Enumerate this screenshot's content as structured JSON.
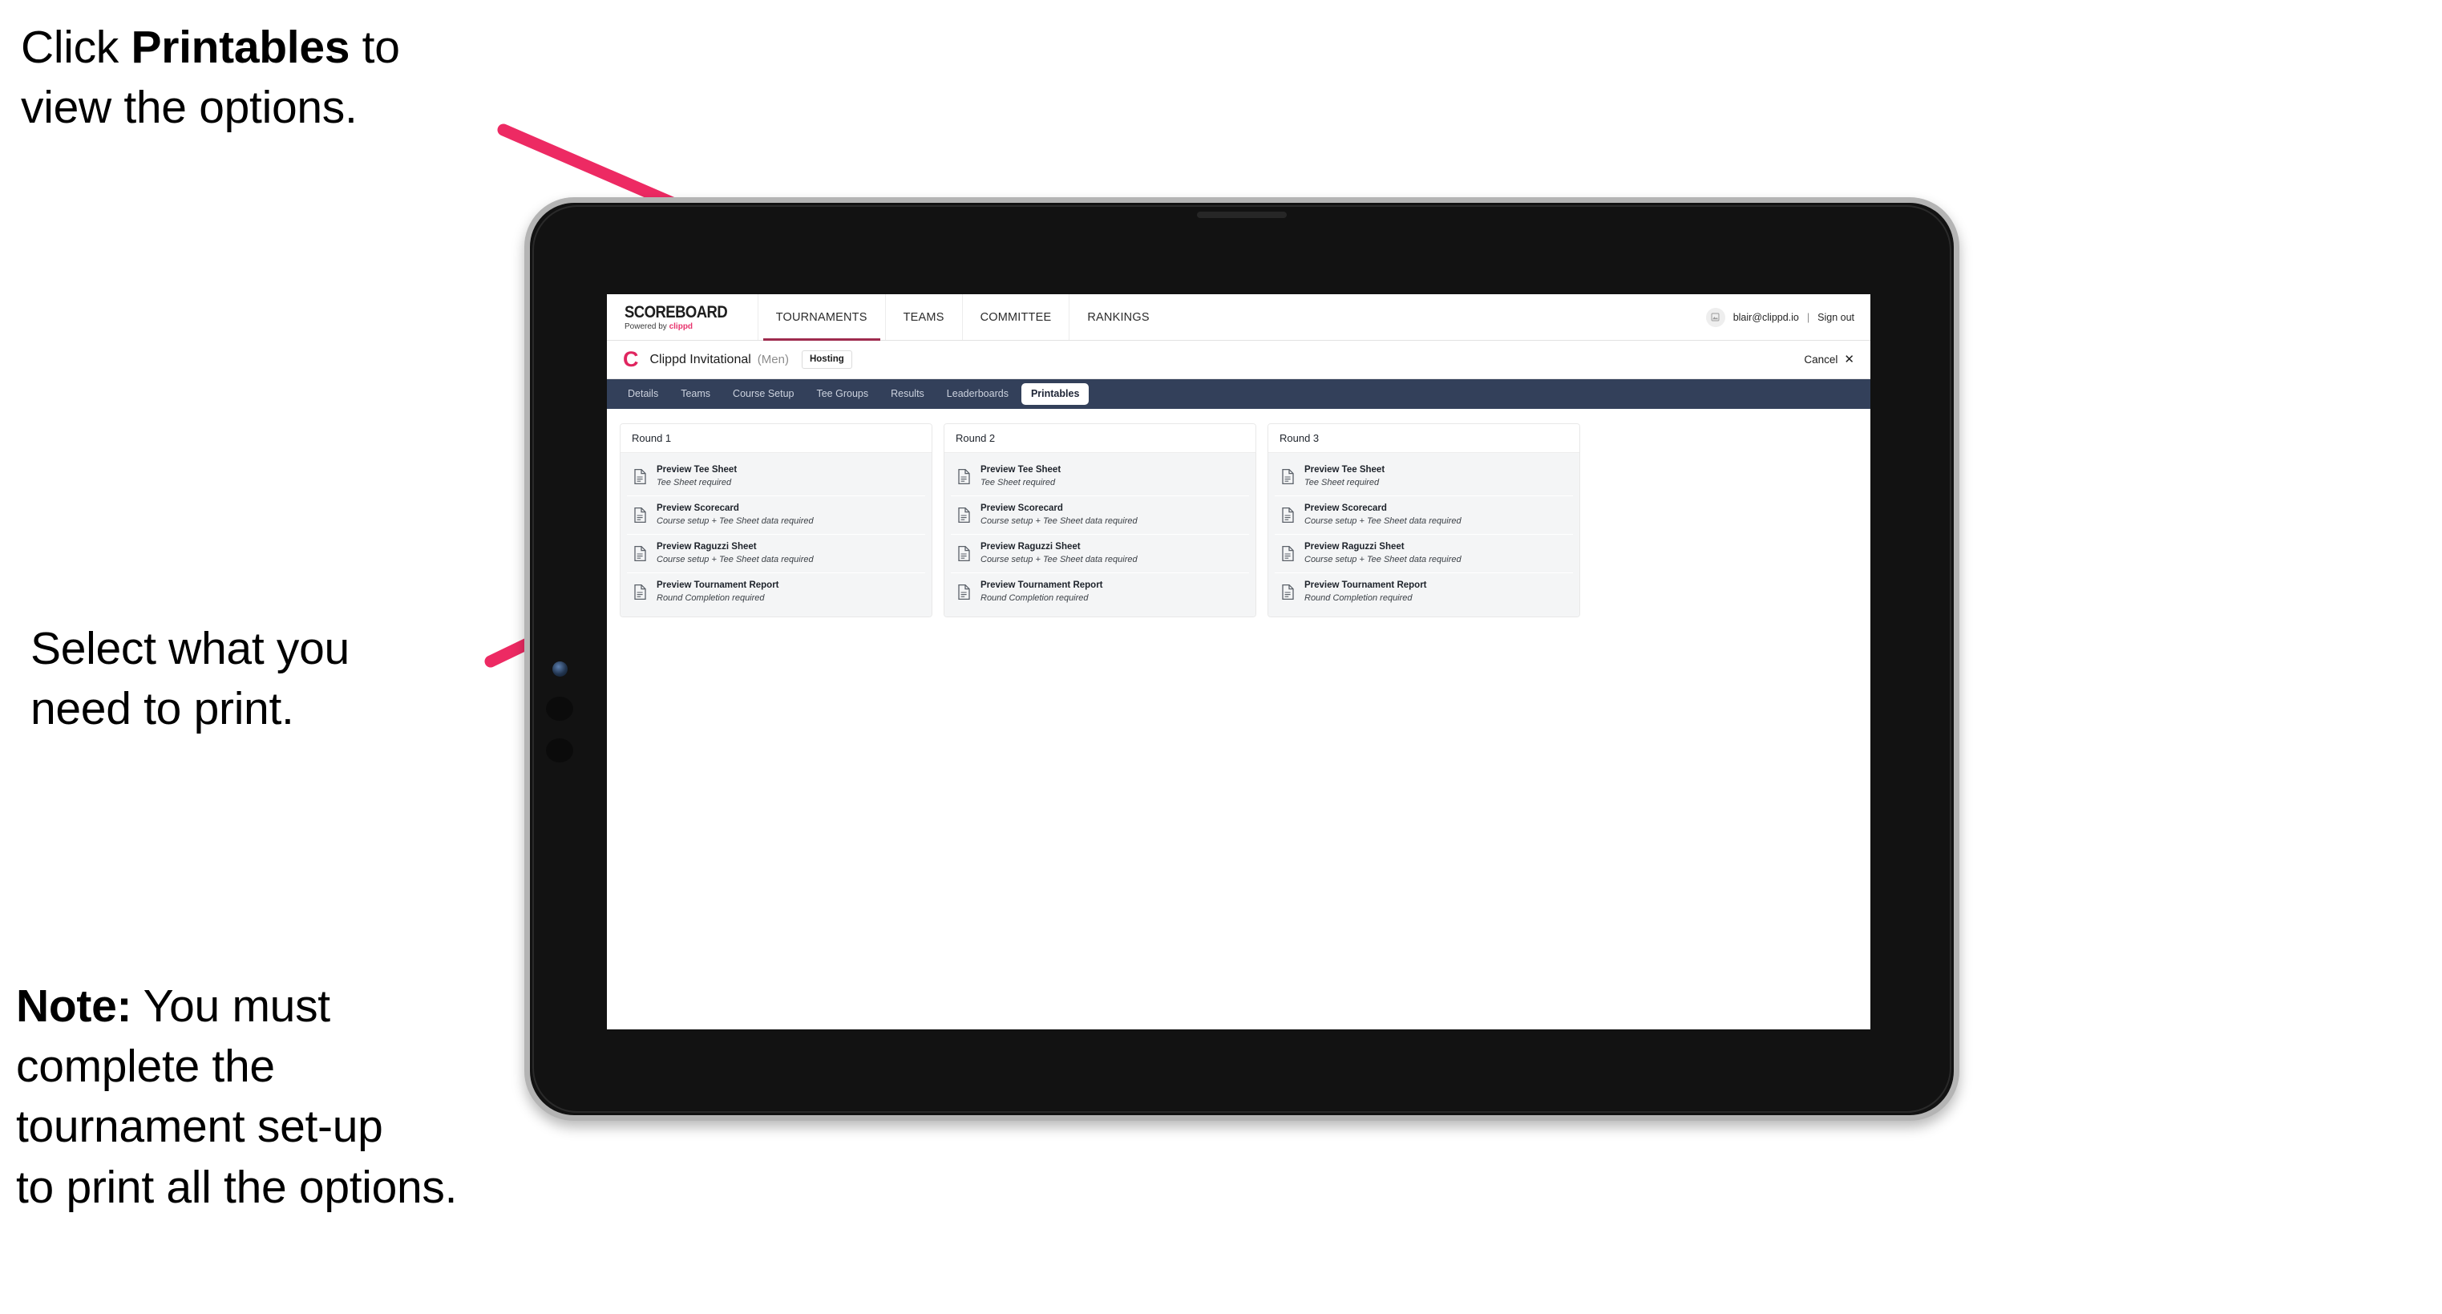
{
  "annotations": {
    "click_printables": "Click ",
    "click_printables_bold": "Printables",
    "click_printables_tail": " to\nview the options.",
    "select_print": "Select what you\n need to print.",
    "note_label": "Note:",
    "note_body": " You must\ncomplete the\ntournament set-up\nto print all the options."
  },
  "colors": {
    "arrow_pink": "#ED2A63",
    "tabstrip_navy": "#33405A",
    "clippd_pink": "#E0255F",
    "nav_active_underline": "#9E2B4E"
  },
  "screen": {
    "topbar": {
      "brand_title": "SCOREBOARD",
      "brand_sub_prefix": "Powered by ",
      "brand_sub_word": "clippd",
      "nav_items": [
        {
          "label": "TOURNAMENTS",
          "active": true
        },
        {
          "label": "TEAMS",
          "active": false
        },
        {
          "label": "COMMITTEE",
          "active": false
        },
        {
          "label": "RANKINGS",
          "active": false
        }
      ],
      "avatar_icon": "user-avatar-icon",
      "user_email": "blair@clippd.io",
      "separator": "|",
      "sign_out": "Sign out"
    },
    "subheader": {
      "logo_letter": "C",
      "tournament_name": "Clippd Invitational",
      "gender": "(Men)",
      "hosting_badge": "Hosting",
      "cancel_label": "Cancel",
      "cancel_icon": "close-icon"
    },
    "tabs": [
      {
        "label": "Details",
        "active": false
      },
      {
        "label": "Teams",
        "active": false
      },
      {
        "label": "Course Setup",
        "active": false
      },
      {
        "label": "Tee Groups",
        "active": false
      },
      {
        "label": "Results",
        "active": false
      },
      {
        "label": "Leaderboards",
        "active": false
      },
      {
        "label": "Printables",
        "active": true
      }
    ],
    "rounds": [
      {
        "title": "Round 1",
        "items": [
          {
            "title": "Preview Tee Sheet",
            "subtitle": "Tee Sheet required"
          },
          {
            "title": "Preview Scorecard",
            "subtitle": "Course setup + Tee Sheet data required"
          },
          {
            "title": "Preview Raguzzi Sheet",
            "subtitle": "Course setup + Tee Sheet data required"
          },
          {
            "title": "Preview Tournament Report",
            "subtitle": "Round Completion required"
          }
        ]
      },
      {
        "title": "Round 2",
        "items": [
          {
            "title": "Preview Tee Sheet",
            "subtitle": "Tee Sheet required"
          },
          {
            "title": "Preview Scorecard",
            "subtitle": "Course setup + Tee Sheet data required"
          },
          {
            "title": "Preview Raguzzi Sheet",
            "subtitle": "Course setup + Tee Sheet data required"
          },
          {
            "title": "Preview Tournament Report",
            "subtitle": "Round Completion required"
          }
        ]
      },
      {
        "title": "Round 3",
        "items": [
          {
            "title": "Preview Tee Sheet",
            "subtitle": "Tee Sheet required"
          },
          {
            "title": "Preview Scorecard",
            "subtitle": "Course setup + Tee Sheet data required"
          },
          {
            "title": "Preview Raguzzi Sheet",
            "subtitle": "Course setup + Tee Sheet data required"
          },
          {
            "title": "Preview Tournament Report",
            "subtitle": "Round Completion required"
          }
        ]
      }
    ]
  }
}
